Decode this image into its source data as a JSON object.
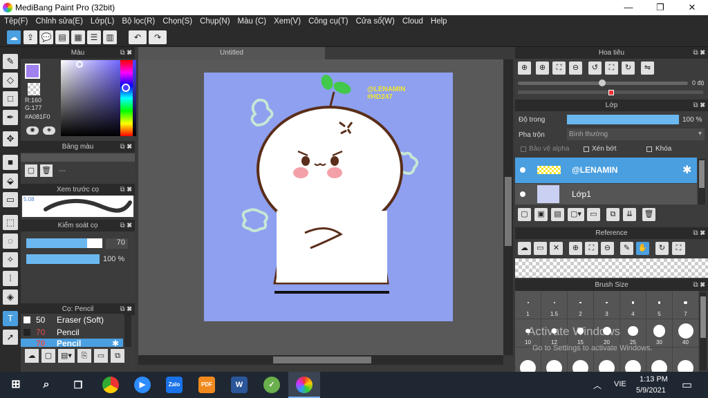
{
  "window": {
    "title": "MediBang Paint Pro (32bit)",
    "minimize": "—",
    "maximize": "❐",
    "close": "✕"
  },
  "menu": [
    "Tệp(F)",
    "Chỉnh sửa(E)",
    "Lớp(L)",
    "Bộ lọc(R)",
    "Chọn(S)",
    "Chụp(N)",
    "Màu (C)",
    "Xem(V)",
    "Công cụ(T)",
    "Cửa sổ(W)",
    "Cloud",
    "Help"
  ],
  "color_panel": {
    "title": "Màu",
    "r": "R:160",
    "g": "G:177",
    "hex": "#A081F0"
  },
  "swatch_panel": {
    "title": "Bảng màu",
    "value": "---"
  },
  "brush_preview": {
    "title": "Xem trước cọ",
    "size": "5.08"
  },
  "brush_control": {
    "title": "Kiểm soát cọ",
    "size": "70",
    "opacity": "100 %"
  },
  "brush_list": {
    "title": "Cọ: Pencil",
    "items": [
      {
        "size": "50",
        "name": "Eraser (Soft)"
      },
      {
        "size": "70",
        "name": "Pencil"
      },
      {
        "size": "70",
        "name": "Pencil"
      }
    ]
  },
  "document": {
    "tab": "Untitled"
  },
  "artwork": {
    "signature": "@LENAMIN",
    "hashtag": "#HD247"
  },
  "navigator": {
    "title": "Hoa tiêu",
    "angle": "0 độ"
  },
  "layer_panel": {
    "title": "Lớp",
    "opacity_label": "Độ trong",
    "opacity_value": "100 %",
    "opacity": 1.0,
    "blend_label": "Pha trộn",
    "blend_value": "Bình thường",
    "protect_alpha": "Bảo vệ alpha",
    "clipping": "Xén bớt",
    "lock": "Khóa",
    "layers": [
      {
        "name": "@LENAMIN",
        "selected": true
      },
      {
        "name": "Lớp1",
        "selected": false
      }
    ]
  },
  "reference_panel": {
    "title": "Reference"
  },
  "brush_size_panel": {
    "title": "Brush Size",
    "row1": [
      "1",
      "1.5",
      "2",
      "3",
      "4",
      "5",
      "7"
    ],
    "row2": [
      "10",
      "12",
      "15",
      "20",
      "25",
      "30",
      "40"
    ]
  },
  "watermark": {
    "line1": "Activate Windows",
    "line2": "Go to Settings to activate Windows."
  },
  "taskbar": {
    "lang": "VIE",
    "time": "1:13 PM",
    "date": "5/9/2021",
    "zalo": "Zalo",
    "pdf": "PDF",
    "word": "W"
  },
  "colors": {
    "accent": "#4a9fe0",
    "fg_color": "#A081F0",
    "canvas_bg": "#8ea0ef"
  }
}
